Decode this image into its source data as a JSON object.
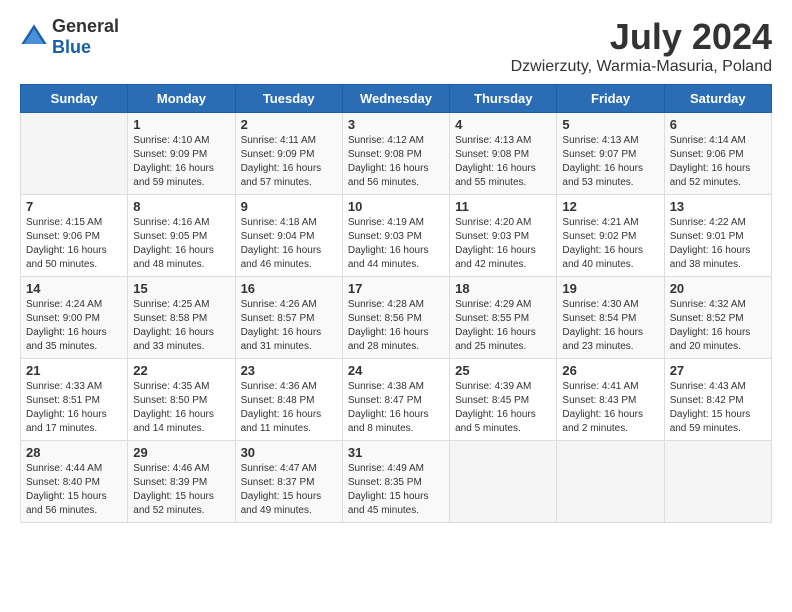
{
  "header": {
    "logo_general": "General",
    "logo_blue": "Blue",
    "title": "July 2024",
    "subtitle": "Dzwierzuty, Warmia-Masuria, Poland"
  },
  "weekdays": [
    "Sunday",
    "Monday",
    "Tuesday",
    "Wednesday",
    "Thursday",
    "Friday",
    "Saturday"
  ],
  "weeks": [
    [
      {
        "day": "",
        "info": ""
      },
      {
        "day": "1",
        "info": "Sunrise: 4:10 AM\nSunset: 9:09 PM\nDaylight: 16 hours\nand 59 minutes."
      },
      {
        "day": "2",
        "info": "Sunrise: 4:11 AM\nSunset: 9:09 PM\nDaylight: 16 hours\nand 57 minutes."
      },
      {
        "day": "3",
        "info": "Sunrise: 4:12 AM\nSunset: 9:08 PM\nDaylight: 16 hours\nand 56 minutes."
      },
      {
        "day": "4",
        "info": "Sunrise: 4:13 AM\nSunset: 9:08 PM\nDaylight: 16 hours\nand 55 minutes."
      },
      {
        "day": "5",
        "info": "Sunrise: 4:13 AM\nSunset: 9:07 PM\nDaylight: 16 hours\nand 53 minutes."
      },
      {
        "day": "6",
        "info": "Sunrise: 4:14 AM\nSunset: 9:06 PM\nDaylight: 16 hours\nand 52 minutes."
      }
    ],
    [
      {
        "day": "7",
        "info": "Sunrise: 4:15 AM\nSunset: 9:06 PM\nDaylight: 16 hours\nand 50 minutes."
      },
      {
        "day": "8",
        "info": "Sunrise: 4:16 AM\nSunset: 9:05 PM\nDaylight: 16 hours\nand 48 minutes."
      },
      {
        "day": "9",
        "info": "Sunrise: 4:18 AM\nSunset: 9:04 PM\nDaylight: 16 hours\nand 46 minutes."
      },
      {
        "day": "10",
        "info": "Sunrise: 4:19 AM\nSunset: 9:03 PM\nDaylight: 16 hours\nand 44 minutes."
      },
      {
        "day": "11",
        "info": "Sunrise: 4:20 AM\nSunset: 9:03 PM\nDaylight: 16 hours\nand 42 minutes."
      },
      {
        "day": "12",
        "info": "Sunrise: 4:21 AM\nSunset: 9:02 PM\nDaylight: 16 hours\nand 40 minutes."
      },
      {
        "day": "13",
        "info": "Sunrise: 4:22 AM\nSunset: 9:01 PM\nDaylight: 16 hours\nand 38 minutes."
      }
    ],
    [
      {
        "day": "14",
        "info": "Sunrise: 4:24 AM\nSunset: 9:00 PM\nDaylight: 16 hours\nand 35 minutes."
      },
      {
        "day": "15",
        "info": "Sunrise: 4:25 AM\nSunset: 8:58 PM\nDaylight: 16 hours\nand 33 minutes."
      },
      {
        "day": "16",
        "info": "Sunrise: 4:26 AM\nSunset: 8:57 PM\nDaylight: 16 hours\nand 31 minutes."
      },
      {
        "day": "17",
        "info": "Sunrise: 4:28 AM\nSunset: 8:56 PM\nDaylight: 16 hours\nand 28 minutes."
      },
      {
        "day": "18",
        "info": "Sunrise: 4:29 AM\nSunset: 8:55 PM\nDaylight: 16 hours\nand 25 minutes."
      },
      {
        "day": "19",
        "info": "Sunrise: 4:30 AM\nSunset: 8:54 PM\nDaylight: 16 hours\nand 23 minutes."
      },
      {
        "day": "20",
        "info": "Sunrise: 4:32 AM\nSunset: 8:52 PM\nDaylight: 16 hours\nand 20 minutes."
      }
    ],
    [
      {
        "day": "21",
        "info": "Sunrise: 4:33 AM\nSunset: 8:51 PM\nDaylight: 16 hours\nand 17 minutes."
      },
      {
        "day": "22",
        "info": "Sunrise: 4:35 AM\nSunset: 8:50 PM\nDaylight: 16 hours\nand 14 minutes."
      },
      {
        "day": "23",
        "info": "Sunrise: 4:36 AM\nSunset: 8:48 PM\nDaylight: 16 hours\nand 11 minutes."
      },
      {
        "day": "24",
        "info": "Sunrise: 4:38 AM\nSunset: 8:47 PM\nDaylight: 16 hours\nand 8 minutes."
      },
      {
        "day": "25",
        "info": "Sunrise: 4:39 AM\nSunset: 8:45 PM\nDaylight: 16 hours\nand 5 minutes."
      },
      {
        "day": "26",
        "info": "Sunrise: 4:41 AM\nSunset: 8:43 PM\nDaylight: 16 hours\nand 2 minutes."
      },
      {
        "day": "27",
        "info": "Sunrise: 4:43 AM\nSunset: 8:42 PM\nDaylight: 15 hours\nand 59 minutes."
      }
    ],
    [
      {
        "day": "28",
        "info": "Sunrise: 4:44 AM\nSunset: 8:40 PM\nDaylight: 15 hours\nand 56 minutes."
      },
      {
        "day": "29",
        "info": "Sunrise: 4:46 AM\nSunset: 8:39 PM\nDaylight: 15 hours\nand 52 minutes."
      },
      {
        "day": "30",
        "info": "Sunrise: 4:47 AM\nSunset: 8:37 PM\nDaylight: 15 hours\nand 49 minutes."
      },
      {
        "day": "31",
        "info": "Sunrise: 4:49 AM\nSunset: 8:35 PM\nDaylight: 15 hours\nand 45 minutes."
      },
      {
        "day": "",
        "info": ""
      },
      {
        "day": "",
        "info": ""
      },
      {
        "day": "",
        "info": ""
      }
    ]
  ]
}
